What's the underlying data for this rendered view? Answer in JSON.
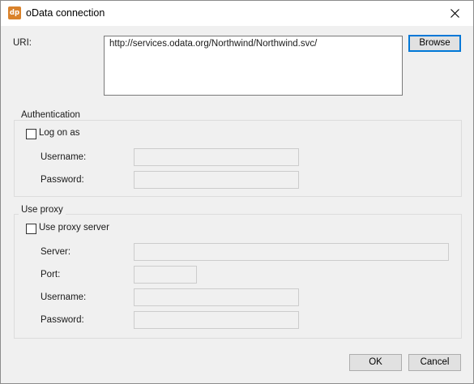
{
  "window": {
    "title": "oData connection",
    "app_icon_text": "dp",
    "close_glyph": "✕"
  },
  "uri": {
    "label": "URI:",
    "value": "http://services.odata.org/Northwind/Northwind.svc/",
    "browse_label": "Browse"
  },
  "authentication": {
    "title": "Authentication",
    "logon_checkbox_label": "Log on as",
    "logon_checked": false,
    "username_label": "Username:",
    "username_value": "",
    "password_label": "Password:",
    "password_value": ""
  },
  "proxy": {
    "title": "Use proxy",
    "use_proxy_checkbox_label": "Use proxy server",
    "use_proxy_checked": false,
    "server_label": "Server:",
    "server_value": "",
    "port_label": "Port:",
    "port_value": "",
    "username_label": "Username:",
    "username_value": "",
    "password_label": "Password:",
    "password_value": ""
  },
  "footer": {
    "ok_label": "OK",
    "cancel_label": "Cancel"
  },
  "colors": {
    "accent": "#0078d7",
    "app_icon": "#d9822b",
    "dialog_bg": "#f0f0f0"
  }
}
